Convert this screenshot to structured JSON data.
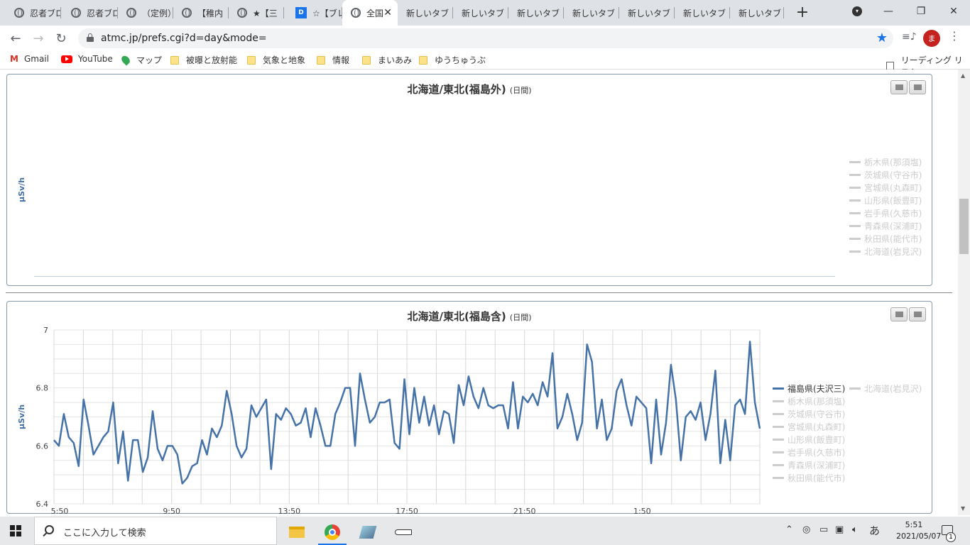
{
  "tabs": [
    {
      "title": "忍者ブロ",
      "icon": "globe-icon"
    },
    {
      "title": "忍者ブロ",
      "icon": "globe-icon"
    },
    {
      "title": "（定例）",
      "icon": "globe-icon"
    },
    {
      "title": "【稚内",
      "icon": "globe-icon"
    },
    {
      "title": "★【三",
      "icon": "globe-icon"
    },
    {
      "title": "☆【ブレ",
      "icon": "dk-icon"
    },
    {
      "title": "全国",
      "icon": "globe-icon",
      "active": true
    },
    {
      "title": "新しいタブ"
    },
    {
      "title": "新しいタブ"
    },
    {
      "title": "新しいタブ"
    },
    {
      "title": "新しいタブ"
    },
    {
      "title": "新しいタブ"
    },
    {
      "title": "新しいタブ"
    },
    {
      "title": "新しいタブ"
    }
  ],
  "toolbar": {
    "url": "atmc.jp/prefs.cgi?d=day&mode=",
    "avatar_initial": "ま"
  },
  "bookmarks": [
    {
      "label": "Gmail",
      "icon": "gmail-icon"
    },
    {
      "label": "YouTube",
      "icon": "youtube-icon"
    },
    {
      "label": "マップ",
      "icon": "maps-pin-icon"
    },
    {
      "label": "被曝と放射能",
      "icon": "folder-icon"
    },
    {
      "label": "気象と地象",
      "icon": "folder-icon"
    },
    {
      "label": "情報",
      "icon": "folder-icon"
    },
    {
      "label": "まいあみ",
      "icon": "folder-icon"
    },
    {
      "label": "ゆうちゅうぶ",
      "icon": "folder-icon"
    }
  ],
  "reading_list": "リーディング リスト",
  "charts": {
    "top": {
      "title": "北海道/東北(福島外)",
      "subtitle": "(日間)",
      "ylabel": "μSv/h",
      "legend": [
        "栃木県(那須塩)",
        "茨城県(守谷市)",
        "宮城県(丸森町)",
        "山形県(飯豊町)",
        "岩手県(久慈市)",
        "青森県(深浦町)",
        "秋田県(能代市)",
        "北海道(岩見沢)"
      ]
    },
    "bottom": {
      "title": "北海道/東北(福島含)",
      "subtitle": "(日間)",
      "ylabel": "μSv/h",
      "legend_col1": [
        "福島県(夫沢三)",
        "栃木県(那須塩)",
        "茨城県(守谷市)",
        "宮城県(丸森町)",
        "山形県(飯豊町)",
        "岩手県(久慈市)",
        "青森県(深浦町)",
        "秋田県(能代市)"
      ],
      "legend_col2": [
        "北海道(岩見沢)"
      ]
    }
  },
  "chart_data": [
    {
      "type": "line",
      "title": "北海道/東北(福島外)",
      "ylabel": "μSv/h",
      "series": [
        {
          "name": "栃木県(那須塩)",
          "values": [],
          "visible": false
        },
        {
          "name": "茨城県(守谷市)",
          "values": [],
          "visible": false
        },
        {
          "name": "宮城県(丸森町)",
          "values": [],
          "visible": false
        },
        {
          "name": "山形県(飯豊町)",
          "values": [],
          "visible": false
        },
        {
          "name": "岩手県(久慈市)",
          "values": [],
          "visible": false
        },
        {
          "name": "青森県(深浦町)",
          "values": [],
          "visible": false
        },
        {
          "name": "秋田県(能代市)",
          "values": [],
          "visible": false
        },
        {
          "name": "北海道(岩見沢)",
          "values": [],
          "visible": false
        }
      ]
    },
    {
      "type": "line",
      "title": "北海道/東北(福島含)",
      "ylabel": "μSv/h",
      "ylim": [
        6.4,
        7.0
      ],
      "yticks": [
        6.4,
        6.6,
        6.8,
        7
      ],
      "xticks": [
        "5:50",
        "9:50",
        "13:50",
        "17:50",
        "21:50",
        "1:50"
      ],
      "grid": true,
      "legend_position": "right",
      "series": [
        {
          "name": "福島県(夫沢三)",
          "color": "#4572a7",
          "visible": true,
          "values": [
            6.62,
            6.6,
            6.71,
            6.63,
            6.61,
            6.53,
            6.76,
            6.67,
            6.57,
            6.6,
            6.63,
            6.65,
            6.75,
            6.54,
            6.65,
            6.48,
            6.62,
            6.62,
            6.51,
            6.56,
            6.72,
            6.59,
            6.55,
            6.6,
            6.6,
            6.57,
            6.47,
            6.49,
            6.53,
            6.54,
            6.62,
            6.57,
            6.66,
            6.63,
            6.67,
            6.79,
            6.71,
            6.6,
            6.56,
            6.59,
            6.74,
            6.7,
            6.73,
            6.76,
            6.52,
            6.71,
            6.69,
            6.73,
            6.71,
            6.67,
            6.68,
            6.73,
            6.63,
            6.73,
            6.67,
            6.6,
            6.6,
            6.71,
            6.75,
            6.8,
            6.8,
            6.6,
            6.85,
            6.76,
            6.68,
            6.7,
            6.75,
            6.75,
            6.76,
            6.61,
            6.59,
            6.83,
            6.64,
            6.8,
            6.68,
            6.77,
            6.67,
            6.74,
            6.64,
            6.72,
            6.71,
            6.61,
            6.81,
            6.74,
            6.84,
            6.77,
            6.73,
            6.8,
            6.74,
            6.73,
            6.74,
            6.74,
            6.66,
            6.82,
            6.66,
            6.77,
            6.75,
            6.78,
            6.74,
            6.82,
            6.77,
            6.92,
            6.66,
            6.7,
            6.78,
            6.71,
            6.62,
            6.68,
            6.95,
            6.89,
            6.66,
            6.76,
            6.62,
            6.66,
            6.79,
            6.83,
            6.74,
            6.67,
            6.77,
            6.75,
            6.73,
            6.54,
            6.76,
            6.57,
            6.68,
            6.88,
            6.76,
            6.55,
            6.7,
            6.72,
            6.69,
            6.75,
            6.62,
            6.71,
            6.86,
            6.54,
            6.69,
            6.55,
            6.74,
            6.76,
            6.71,
            6.96,
            6.75,
            6.66
          ]
        },
        {
          "name": "北海道(岩見沢)",
          "values": [],
          "visible": false
        },
        {
          "name": "栃木県(那須塩)",
          "values": [],
          "visible": false
        },
        {
          "name": "茨城県(守谷市)",
          "values": [],
          "visible": false
        },
        {
          "name": "宮城県(丸森町)",
          "values": [],
          "visible": false
        },
        {
          "name": "山形県(飯豊町)",
          "values": [],
          "visible": false
        },
        {
          "name": "岩手県(久慈市)",
          "values": [],
          "visible": false
        },
        {
          "name": "青森県(深浦町)",
          "values": [],
          "visible": false
        },
        {
          "name": "秋田県(能代市)",
          "values": [],
          "visible": false
        }
      ]
    }
  ],
  "taskbar": {
    "search_placeholder": "ここに入力して検索",
    "time": "5:51",
    "date": "2021/05/07",
    "ime": "あ",
    "notification_count": "1"
  }
}
